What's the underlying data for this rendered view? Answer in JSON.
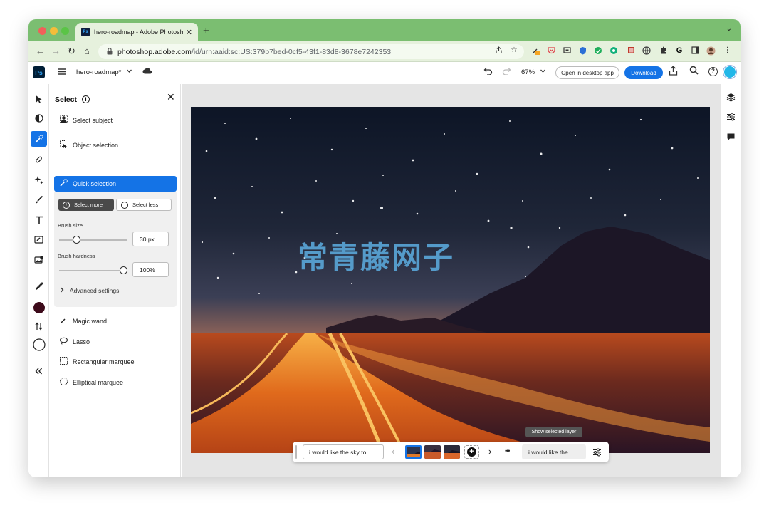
{
  "browser": {
    "tab_title": "hero-roadmap - Adobe Photosho",
    "tab_favicon": "Ps",
    "close_tab_glyph": "✕",
    "new_tab_glyph": "+",
    "tab_menu_glyph": "⌄",
    "url_domain": "photoshop.adobe.com",
    "url_path": "/id/urn:aaid:sc:US:379b7bed-0cf5-43f1-83d8-3678e7242353",
    "nav": {
      "back": "←",
      "forward": "→",
      "reload": "↻",
      "home": "⌂"
    },
    "extension_icons": [
      "share-icon",
      "star-icon",
      "puzzle-ext-icon",
      "pocket-icon",
      "screen-icon",
      "shield-icon",
      "leaf-icon",
      "grammarly-icon",
      "book-icon",
      "globe-icon",
      "extensions-icon",
      "g-icon",
      "sidepanel-icon",
      "profile-icon",
      "kebab-icon"
    ]
  },
  "header": {
    "logo": "Ps",
    "doc_name": "hero-roadmap*",
    "zoom": "67%",
    "open_desktop_label": "Open in desktop app",
    "download_label": "Download",
    "help_glyph": "?"
  },
  "panel": {
    "title": "Select",
    "info_glyph": "i",
    "close_glyph": "✕",
    "select_subject": "Select subject",
    "object_selection": "Object selection",
    "quick_selection": "Quick selection",
    "select_more": "Select more",
    "select_less": "Select less",
    "brush_size_label": "Brush size",
    "brush_size_value": "30 px",
    "brush_size_level": 0.22,
    "brush_hardness_label": "Brush hardness",
    "brush_hardness_value": "100%",
    "brush_hardness_level": 1.0,
    "advanced_settings": "Advanced settings",
    "magic_wand": "Magic wand",
    "lasso": "Lasso",
    "rect_marquee": "Rectangular marquee",
    "ellipse_marquee": "Elliptical marquee"
  },
  "canvas": {
    "watermark_text": "常青藤网子",
    "colors": {
      "sky_top": "#0d1526",
      "sky_mid": "#2e3448",
      "horizon": "#f0903a",
      "road": "#e86a1a",
      "mountain": "#1c1626"
    }
  },
  "taskbar": {
    "prompt_left": "i would like the sky to...",
    "prompt_right": "i would like the ...",
    "prev_glyph": "‹",
    "next_glyph": "›",
    "more_glyph": "•••",
    "add_glyph": "+",
    "tooltip": "Show selected layer"
  },
  "colors": {
    "accent": "#1473e6",
    "foreground_color": "#3d0a1a",
    "tab_strip": "#7bbe71"
  }
}
